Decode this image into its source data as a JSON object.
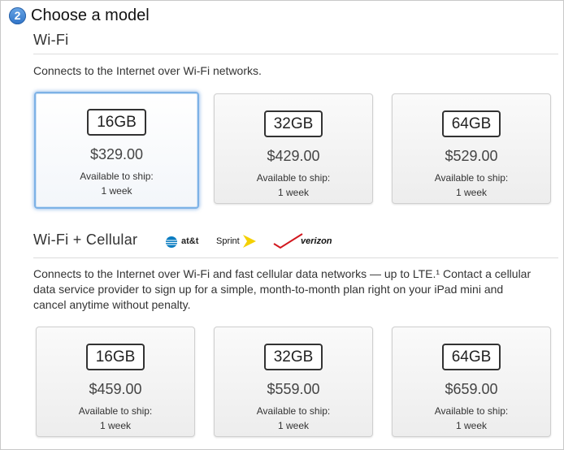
{
  "step": {
    "number": "2",
    "title": "Choose a model"
  },
  "wifi": {
    "title": "Wi-Fi",
    "description": "Connects to the Internet over Wi-Fi networks.",
    "options": [
      {
        "capacity": "16GB",
        "price": "$329.00",
        "ship_label": "Available to ship:",
        "ship_time": "1 week",
        "selected": true
      },
      {
        "capacity": "32GB",
        "price": "$429.00",
        "ship_label": "Available to ship:",
        "ship_time": "1 week",
        "selected": false
      },
      {
        "capacity": "64GB",
        "price": "$529.00",
        "ship_label": "Available to ship:",
        "ship_time": "1 week",
        "selected": false
      }
    ]
  },
  "cellular": {
    "title": "Wi-Fi + Cellular",
    "carriers": {
      "att": "at&t",
      "sprint": "Sprint",
      "verizon": "verizon"
    },
    "description_line1": "Connects to the Internet over Wi-Fi and fast cellular data networks — up to LTE.¹ Contact a cellular",
    "description_line2": "data service provider to sign up for a simple, month-to-month plan right on your iPad mini and",
    "description_line3": "cancel anytime without penalty.",
    "options": [
      {
        "capacity": "16GB",
        "price": "$459.00",
        "ship_label": "Available to ship:",
        "ship_time": "1 week",
        "selected": false
      },
      {
        "capacity": "32GB",
        "price": "$559.00",
        "ship_label": "Available to ship:",
        "ship_time": "1 week",
        "selected": false
      },
      {
        "capacity": "64GB",
        "price": "$659.00",
        "ship_label": "Available to ship:",
        "ship_time": "1 week",
        "selected": false
      }
    ]
  },
  "colors": {
    "selected_border": "#7db2e6",
    "step_badge": "#2f74c8",
    "sprint_yellow": "#f4d000",
    "verizon_red": "#d2171e",
    "att_blue": "#0a7cc1"
  }
}
